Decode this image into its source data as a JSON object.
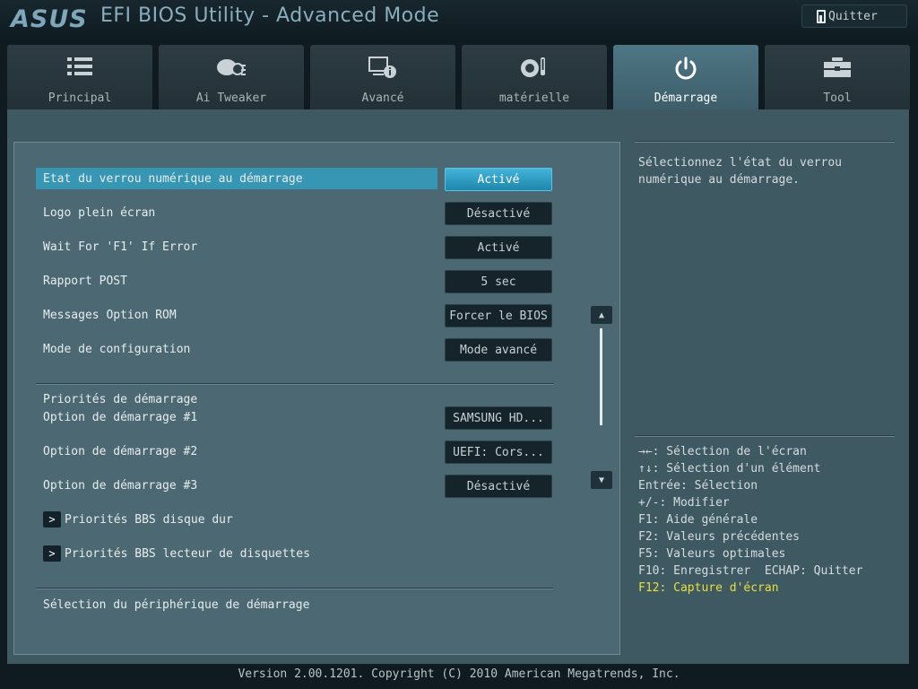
{
  "header": {
    "logo": "ASUS",
    "title": "EFI BIOS Utility - Advanced Mode",
    "quit_label": "Quitter"
  },
  "tabs": [
    {
      "label": "Principal",
      "icon": "list-icon"
    },
    {
      "label": "Ai Tweaker",
      "icon": "tweaker-icon"
    },
    {
      "label": "Avancé",
      "icon": "advanced-icon"
    },
    {
      "label": "matérielle",
      "icon": "monitor-icon"
    },
    {
      "label": "Démarrage",
      "icon": "power-icon",
      "active": true
    },
    {
      "label": "Tool",
      "icon": "toolbox-icon"
    }
  ],
  "settings": [
    {
      "label": "Etat du verrou numérique au démarrage",
      "value": "Activé",
      "selected": true
    },
    {
      "label": "Logo plein écran",
      "value": "Désactivé"
    },
    {
      "label": "Wait For 'F1' If Error",
      "value": "Activé"
    },
    {
      "label": "Rapport POST",
      "value": "5 sec"
    },
    {
      "label": "Messages Option ROM",
      "value": "Forcer le BIOS"
    },
    {
      "label": "Mode de configuration",
      "value": "Mode avancé"
    }
  ],
  "boot": {
    "section_title": "Priorités de démarrage",
    "options": [
      {
        "label": "Option de démarrage #1",
        "value": "SAMSUNG HD..."
      },
      {
        "label": "Option de démarrage #2",
        "value": "UEFI: Cors..."
      },
      {
        "label": "Option de démarrage #3",
        "value": "Désactivé"
      }
    ],
    "submenus": [
      {
        "label": "Priorités BBS disque dur"
      },
      {
        "label": "Priorités BBS lecteur de disquettes"
      }
    ],
    "bottom_label": "Sélection du périphérique de démarrage"
  },
  "help": {
    "text": "Sélectionnez l'état du verrou numérique au démarrage."
  },
  "keys": [
    {
      "text": "→←: Sélection de l'écran"
    },
    {
      "text": "↑↓: Sélection d'un élément"
    },
    {
      "text": "Entrée: Sélection"
    },
    {
      "text": "+/-: Modifier"
    },
    {
      "text": "F1: Aide générale"
    },
    {
      "text": "F2: Valeurs précédentes"
    },
    {
      "text": "F5: Valeurs optimales"
    },
    {
      "text": "F10: Enregistrer  ECHAP: Quitter"
    },
    {
      "text": "F12: Capture d'écran",
      "highlight": true
    }
  ],
  "footer": {
    "version": "Version 2.00.1201. Copyright (C) 2010 American Megatrends, Inc."
  },
  "colors": {
    "accent": "#3796b3",
    "active_tab": "#4e7684",
    "panel": "#4c6973",
    "highlight_key": "#e7e03c"
  }
}
